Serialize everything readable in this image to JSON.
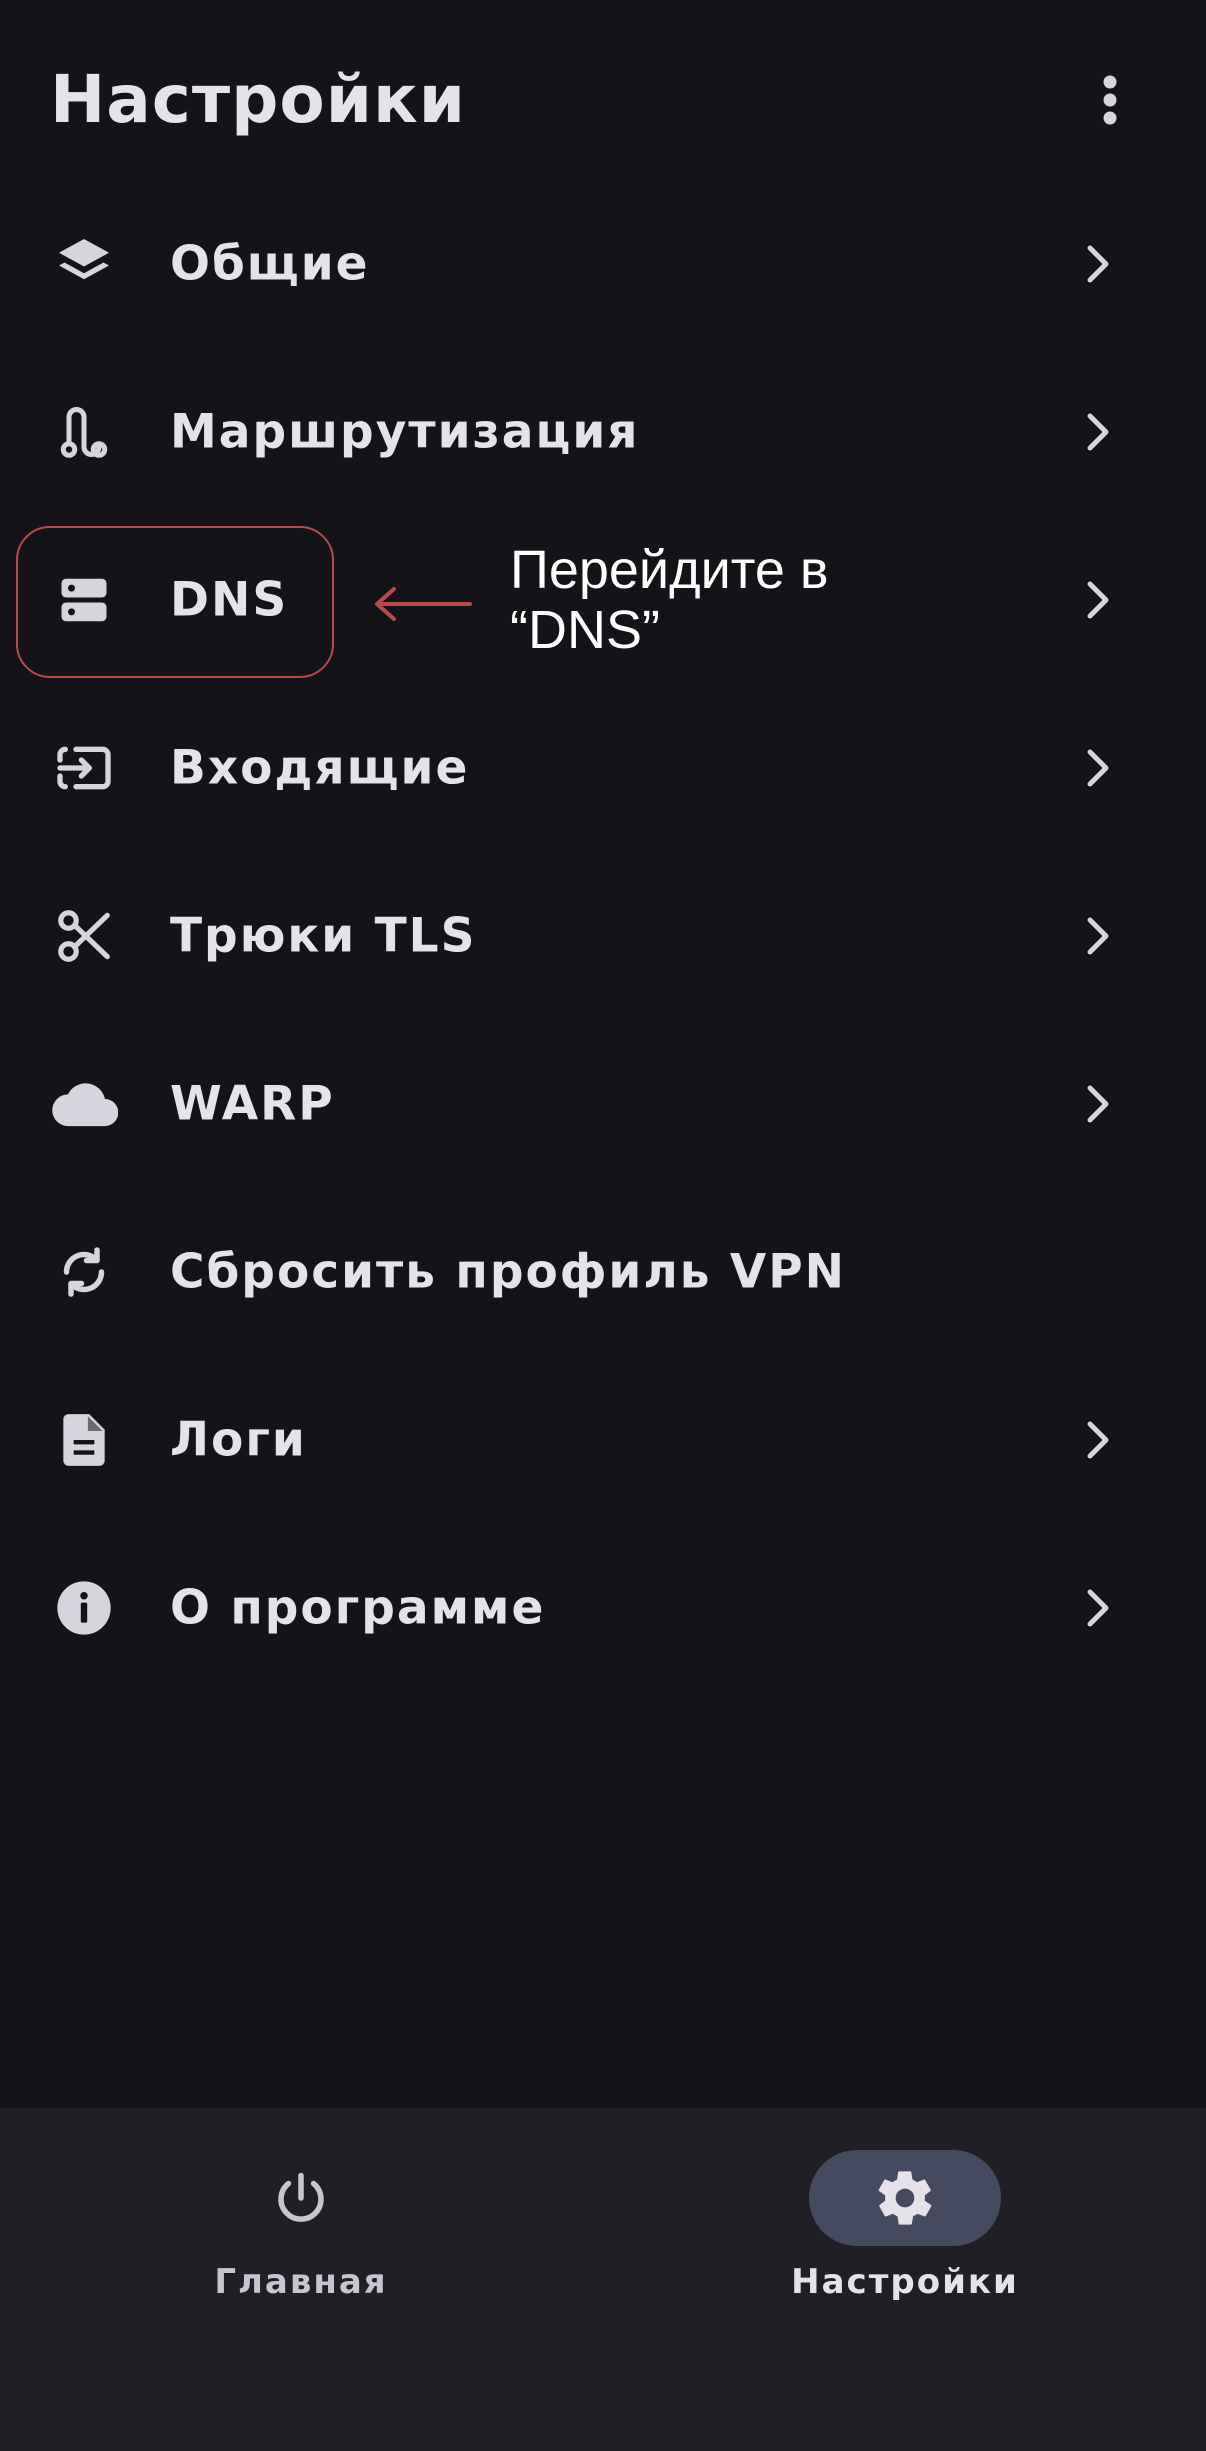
{
  "header": {
    "title": "Настройки",
    "more_icon": "more-vertical-icon"
  },
  "menu": {
    "items": [
      {
        "label": "Общие",
        "icon": "layers-icon",
        "has_chevron": true
      },
      {
        "label": "Маршрутизация",
        "icon": "route-icon",
        "has_chevron": true
      },
      {
        "label": "DNS",
        "icon": "dns-icon",
        "has_chevron": true
      },
      {
        "label": "Входящие",
        "icon": "input-icon",
        "has_chevron": true
      },
      {
        "label": "Трюки TLS",
        "icon": "scissors-icon",
        "has_chevron": true
      },
      {
        "label": "WARP",
        "icon": "cloud-icon",
        "has_chevron": true
      },
      {
        "label": "Сбросить профиль VPN",
        "icon": "sync-icon",
        "has_chevron": false
      },
      {
        "label": "Логи",
        "icon": "file-icon",
        "has_chevron": true
      },
      {
        "label": "О программе",
        "icon": "info-icon",
        "has_chevron": true
      }
    ]
  },
  "annotation": {
    "text": "Перейдите в “DNS”",
    "color": "#b84a4a"
  },
  "bottom_nav": {
    "items": [
      {
        "label": "Главная",
        "icon": "power-icon",
        "active": false
      },
      {
        "label": "Настройки",
        "icon": "gear-icon",
        "active": true
      }
    ]
  },
  "colors": {
    "background": "#131318",
    "nav_background": "#1f1f25",
    "text": "#e6e2ea",
    "active_pill": "#454a60",
    "highlight": "#b84a4a"
  }
}
